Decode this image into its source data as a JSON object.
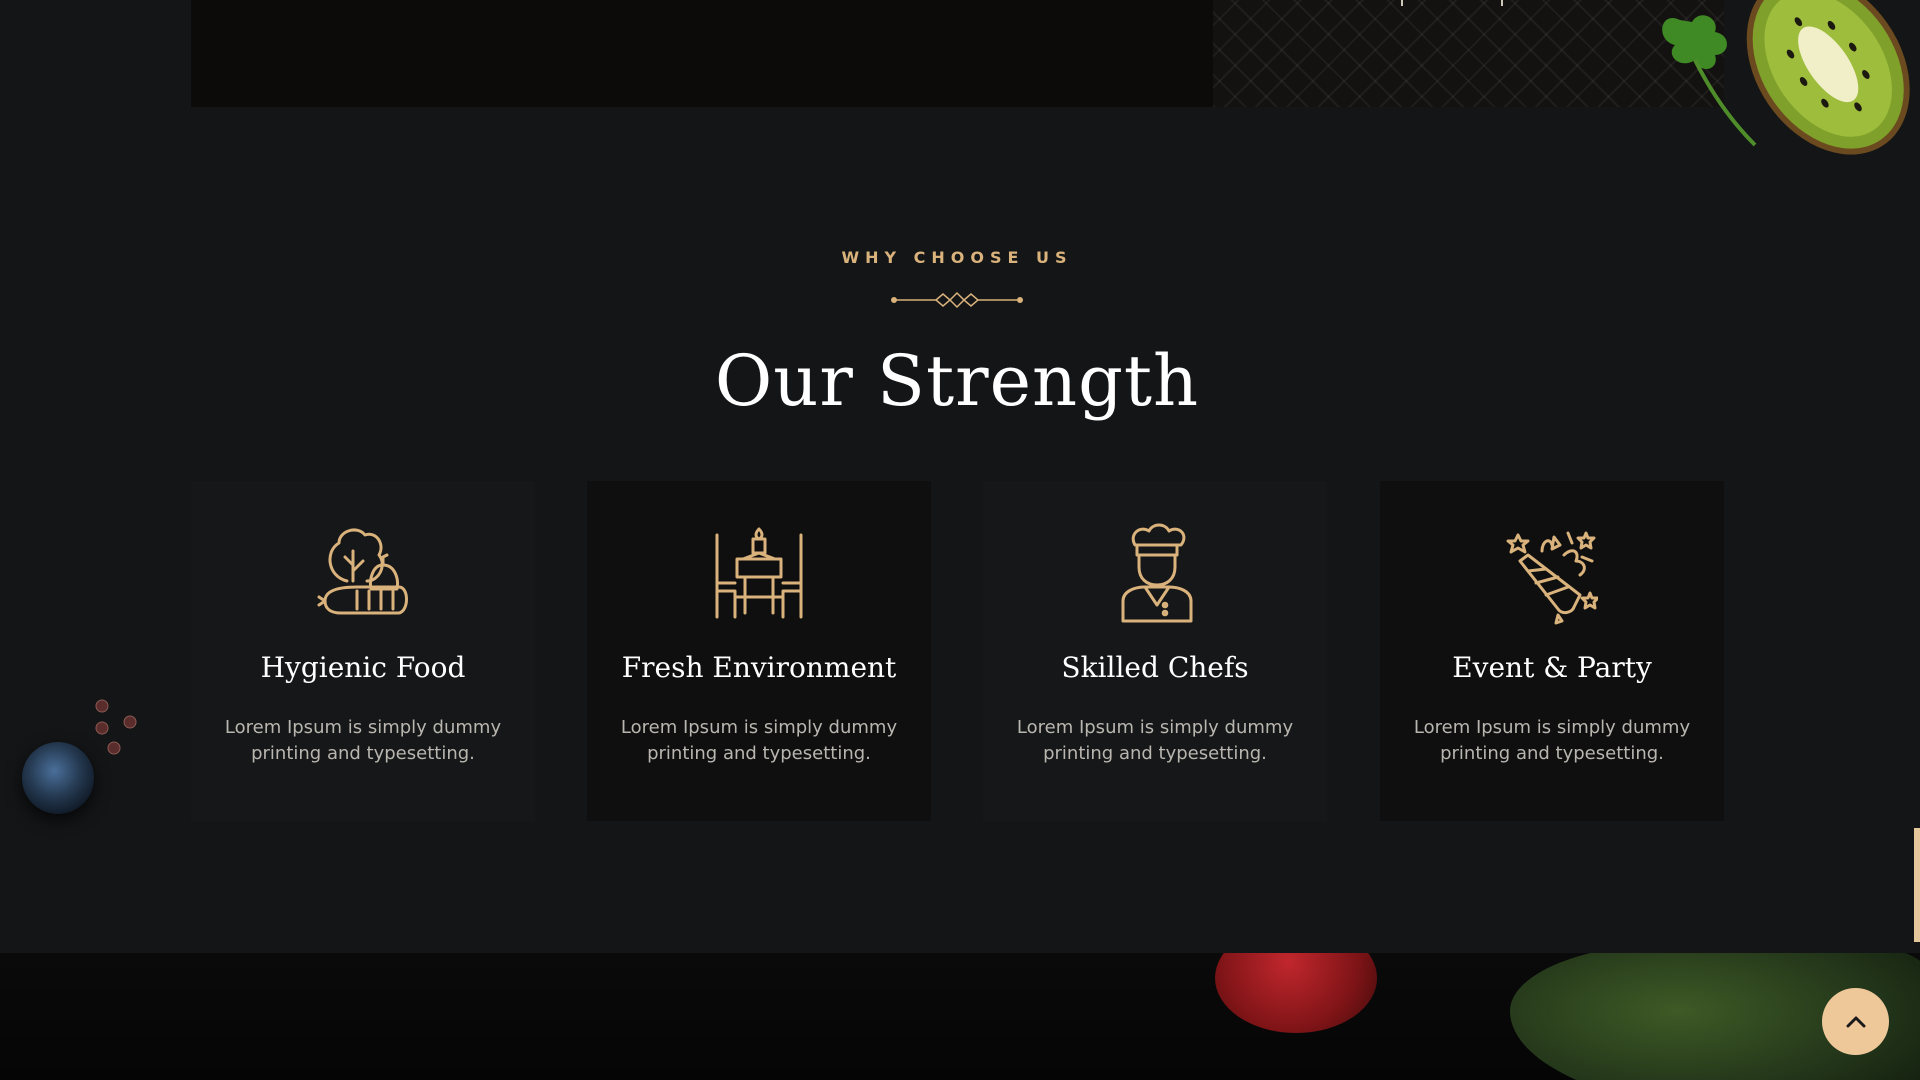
{
  "section": {
    "eyebrow": "WHY CHOOSE US",
    "title": "Our Strength"
  },
  "cards": [
    {
      "title": "Hygienic Food",
      "text": "Lorem Ipsum is simply dummy printing and typesetting.",
      "icon": "vegetables-icon"
    },
    {
      "title": "Fresh Environment",
      "text": "Lorem Ipsum is simply dummy printing and typesetting.",
      "icon": "dining-table-icon"
    },
    {
      "title": "Skilled Chefs",
      "text": "Lorem Ipsum is simply dummy printing and typesetting.",
      "icon": "chef-icon"
    },
    {
      "title": "Event & Party",
      "text": "Lorem Ipsum is simply dummy printing and typesetting.",
      "icon": "party-popper-icon"
    }
  ],
  "scroll_top": {
    "icon": "chevron-up-icon"
  },
  "colors": {
    "accent": "#d9b27c",
    "background": "#141517",
    "card": "#161718",
    "card_active": "#0f0f10",
    "button": "#efc89a"
  }
}
